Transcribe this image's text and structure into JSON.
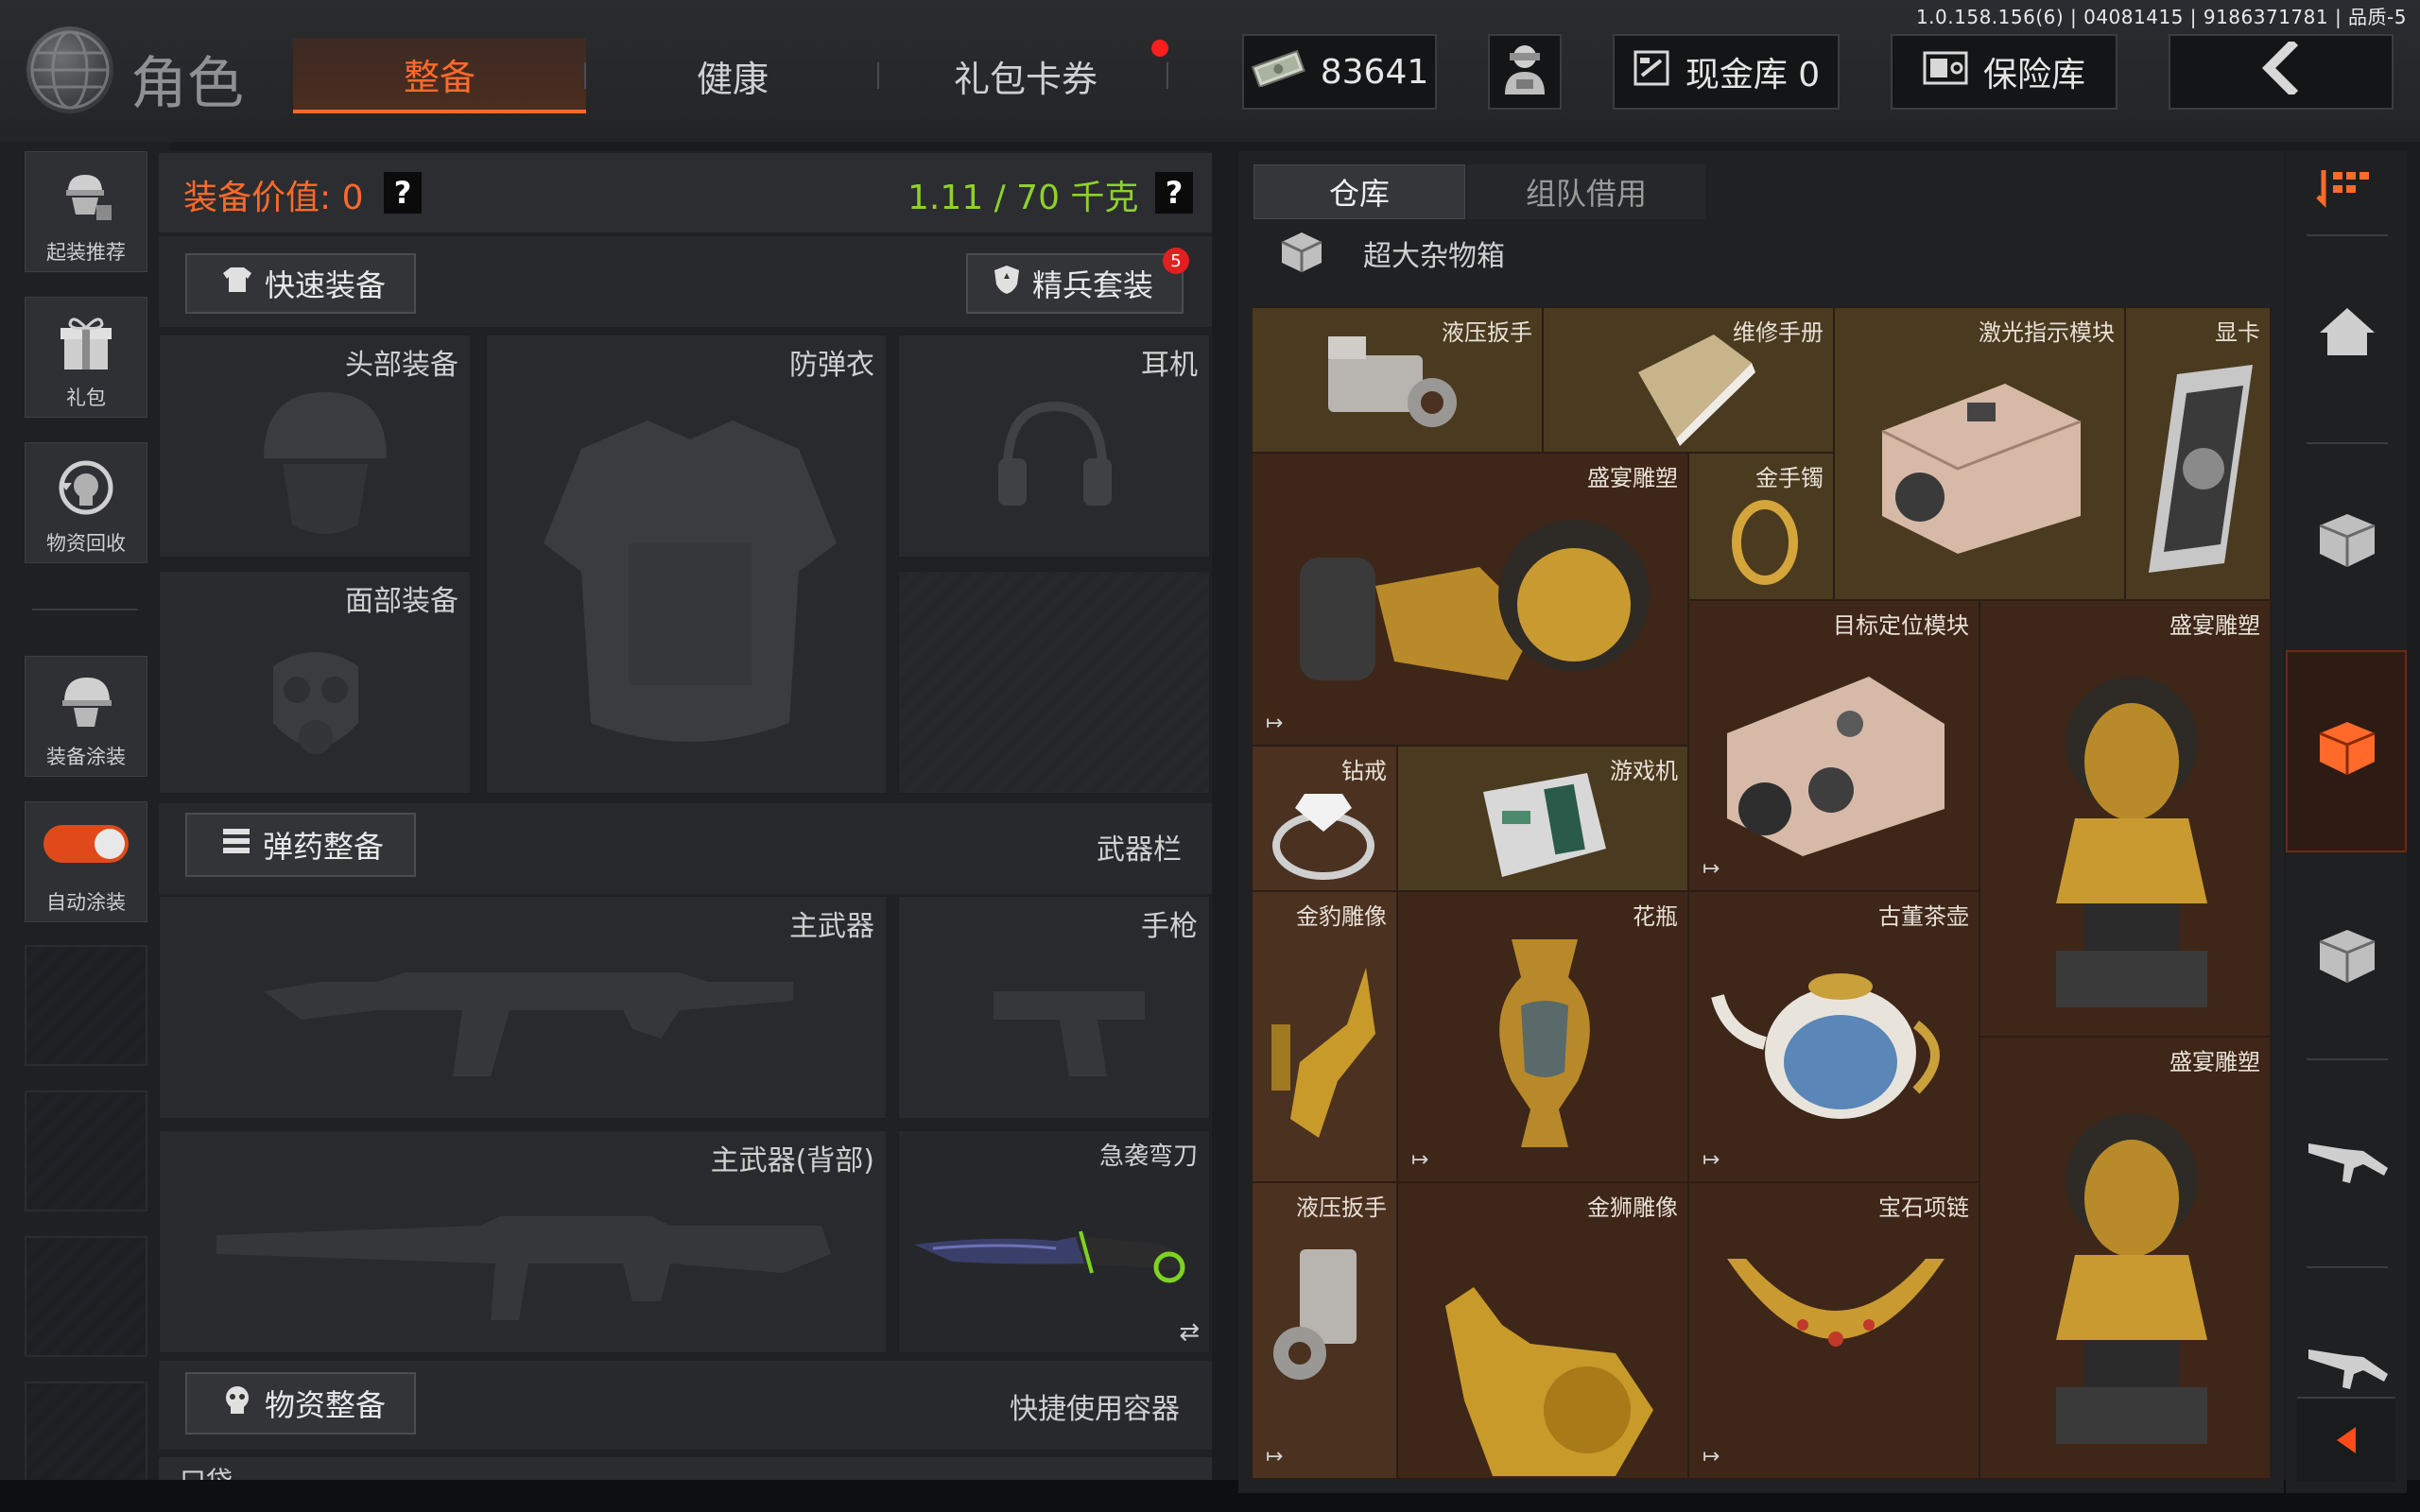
{
  "version": "1.0.158.156(6) | 04081415 | 9186371781 | 品质-5",
  "header": {
    "title": "角色",
    "tabs": [
      {
        "label": "整备",
        "active": true
      },
      {
        "label": "健康",
        "active": false
      },
      {
        "label": "礼包卡券",
        "active": false,
        "has_dot": true
      }
    ],
    "money": "83641",
    "cash_vault": "现金库 0",
    "safe": "保险库"
  },
  "sidebar": {
    "items": [
      {
        "label": "起装推荐",
        "icon": "soldier-icon"
      },
      {
        "label": "礼包",
        "icon": "gift-icon"
      },
      {
        "label": "物资回收",
        "icon": "recycle-icon"
      },
      {
        "label": "装备涂装",
        "icon": "paint-helmet-icon"
      },
      {
        "label": "自动涂装",
        "icon": "toggle-icon",
        "toggle_on": true
      }
    ]
  },
  "equipment": {
    "value_label": "装备价值: 0",
    "weight": "1.11 / 70 千克",
    "quick_equip": "快速装备",
    "elite_set": "精兵套装",
    "elite_badge": "5",
    "slots": {
      "head": "头部装备",
      "armor": "防弹衣",
      "headset": "耳机",
      "face": "面部装备",
      "primary": "主武器",
      "pistol": "手枪",
      "primary_back": "主武器(背部)",
      "melee": "急袭弯刀"
    },
    "ammo_button": "弹药整备",
    "weapon_bar": "武器栏",
    "supply_button": "物资整备",
    "quick_container": "快捷使用容器",
    "pocket": "口袋"
  },
  "warehouse": {
    "tabs": [
      {
        "label": "仓库",
        "active": true
      },
      {
        "label": "组队借用",
        "active": false
      }
    ],
    "container": "超大杂物箱",
    "items": [
      {
        "name": "液压扳手"
      },
      {
        "name": "维修手册"
      },
      {
        "name": "激光指示模块"
      },
      {
        "name": "显卡"
      },
      {
        "name": "盛宴雕塑"
      },
      {
        "name": "金手镯"
      },
      {
        "name": "目标定位模块"
      },
      {
        "name": "盛宴雕塑"
      },
      {
        "name": "钻戒"
      },
      {
        "name": "游戏机"
      },
      {
        "name": "金豹雕像"
      },
      {
        "name": "花瓶"
      },
      {
        "name": "古董茶壶"
      },
      {
        "name": "盛宴雕塑"
      },
      {
        "name": "液压扳手"
      },
      {
        "name": "金狮雕像"
      },
      {
        "name": "宝石项链"
      }
    ]
  },
  "colors": {
    "accent": "#ff6a2a",
    "weight_green": "#8ed12a",
    "value_orange": "#ff6a2a",
    "grid_brown": "#4b3120"
  }
}
